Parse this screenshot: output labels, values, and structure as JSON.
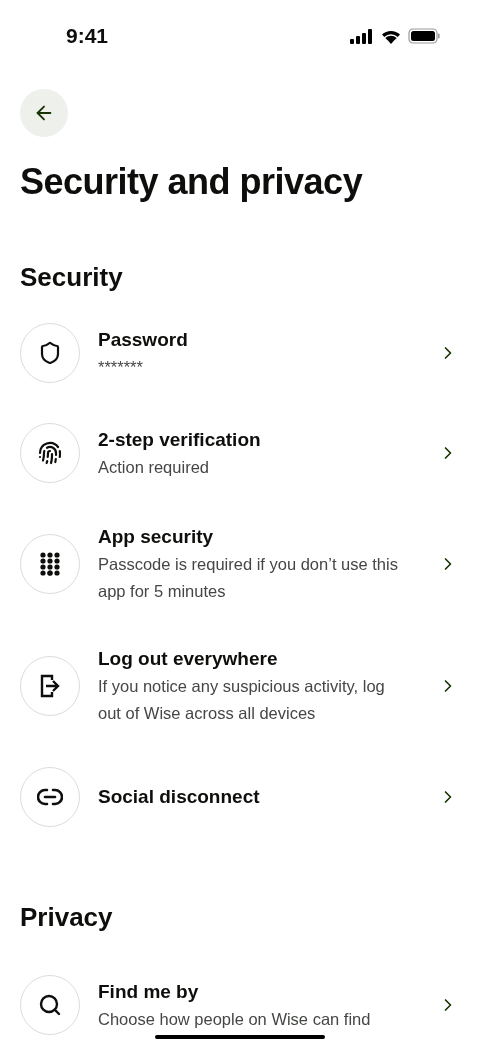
{
  "status_bar": {
    "time": "9:41"
  },
  "title": "Security and privacy",
  "sections": [
    {
      "heading": "Security",
      "items": [
        {
          "kind": "shield",
          "title": "Password",
          "subtitle": "*******"
        },
        {
          "kind": "fingerprint",
          "title": "2-step verification",
          "subtitle": "Action required"
        },
        {
          "kind": "keypad",
          "title": "App security",
          "subtitle": "Passcode is required if you don’t use this app for 5 minutes"
        },
        {
          "kind": "logout",
          "title": "Log out everywhere",
          "subtitle": "If you notice any suspicious activity, log out of Wise across all devices"
        },
        {
          "kind": "link",
          "title": "Social disconnect"
        }
      ]
    },
    {
      "heading": "Privacy",
      "items": [
        {
          "kind": "search",
          "title": "Find me by",
          "subtitle": "Choose how people on Wise can find"
        }
      ]
    }
  ]
}
